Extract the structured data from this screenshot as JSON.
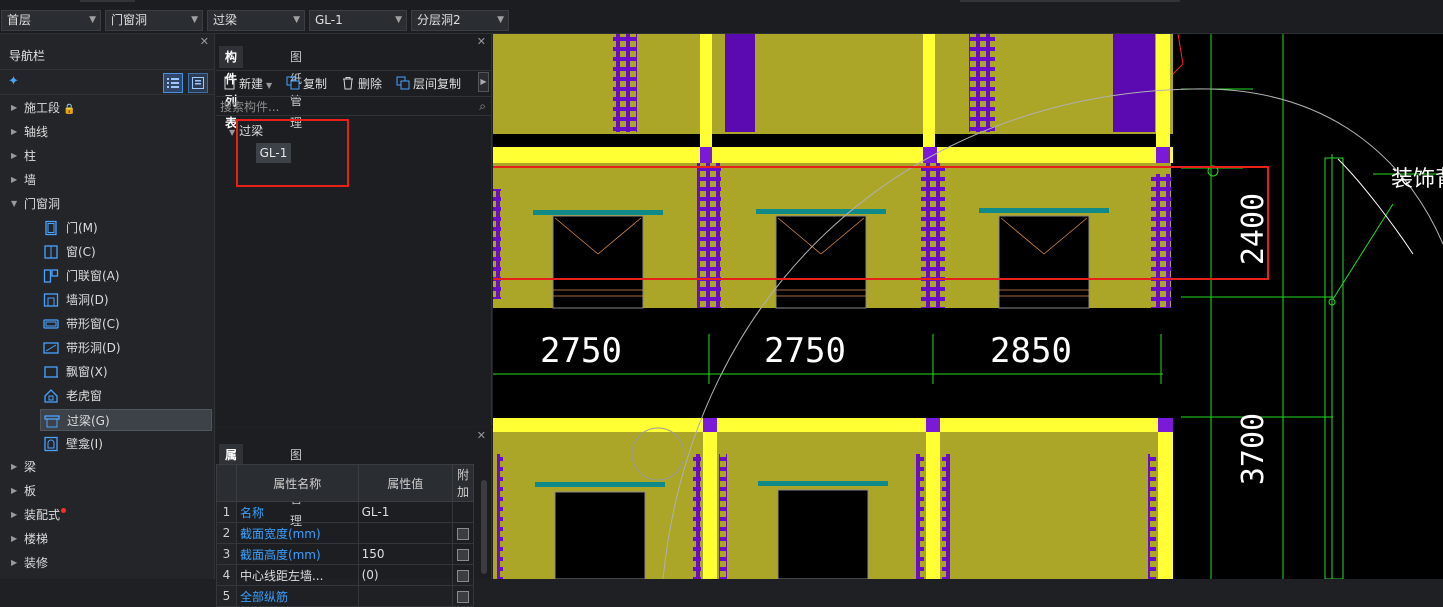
{
  "toolbar": {
    "combos": [
      {
        "name": "floor-select",
        "value": "首层"
      },
      {
        "name": "category-select",
        "value": "门窗洞"
      },
      {
        "name": "component-type-select",
        "value": "过梁"
      },
      {
        "name": "component-select",
        "value": "GL-1"
      },
      {
        "name": "layer-select",
        "value": "分层洞2"
      }
    ]
  },
  "nav": {
    "title": "导航栏",
    "top_items_before": [
      "施工段",
      "轴线",
      "柱",
      "墙"
    ],
    "expanded": "门窗洞",
    "sub_items": [
      {
        "label": "门(M)",
        "icon": "door-icon"
      },
      {
        "label": "窗(C)",
        "icon": "window-icon"
      },
      {
        "label": "门联窗(A)",
        "icon": "door-window-icon"
      },
      {
        "label": "墙洞(D)",
        "icon": "wall-opening-icon"
      },
      {
        "label": "带形窗(C)",
        "icon": "strip-window-icon"
      },
      {
        "label": "带形洞(D)",
        "icon": "strip-opening-icon"
      },
      {
        "label": "飘窗(X)",
        "icon": "bay-window-icon"
      },
      {
        "label": "老虎窗",
        "icon": "dormer-window-icon"
      },
      {
        "label": "过梁(G)",
        "icon": "lintel-icon",
        "selected": true
      },
      {
        "label": "壁龛(I)",
        "icon": "niche-icon"
      }
    ],
    "top_items_after": [
      "梁",
      "板",
      "装配式",
      "楼梯",
      "装修"
    ]
  },
  "component_list": {
    "tabs": [
      "构件列表",
      "图纸管理"
    ],
    "actions": {
      "new": "新建",
      "copy": "复制",
      "delete": "删除",
      "floor_copy": "层间复制"
    },
    "search_placeholder": "搜索构件...",
    "tree_parent": "过梁",
    "tree_child": "GL-1"
  },
  "properties": {
    "tabs": [
      "属性列表",
      "图层管理"
    ],
    "headers": {
      "name": "属性名称",
      "value": "属性值",
      "extra": "附加"
    },
    "rows": [
      {
        "num": "1",
        "name": "名称",
        "value": "GL-1",
        "blue": true,
        "checkbox": false
      },
      {
        "num": "2",
        "name": "截面宽度(mm)",
        "value": "",
        "blue": true,
        "checkbox": true
      },
      {
        "num": "3",
        "name": "截面高度(mm)",
        "value": "150",
        "blue": true,
        "checkbox": true
      },
      {
        "num": "4",
        "name": "中心线距左墙...",
        "value": "(0)",
        "blue": false,
        "checkbox": true
      },
      {
        "num": "5",
        "name": "全部纵筋",
        "value": "",
        "blue": true,
        "checkbox": true
      }
    ]
  },
  "canvas": {
    "dims": [
      "2750",
      "2750",
      "2850"
    ],
    "vdims": [
      "2400",
      "3700"
    ],
    "side_label": "装饰背景"
  },
  "colors": {
    "wall": "#aba628",
    "column": "#ffff33",
    "rebar": "#6a0dc8",
    "lintel": "#108a88",
    "highlight": "#e8201a",
    "accent": "#3aa0ff"
  }
}
